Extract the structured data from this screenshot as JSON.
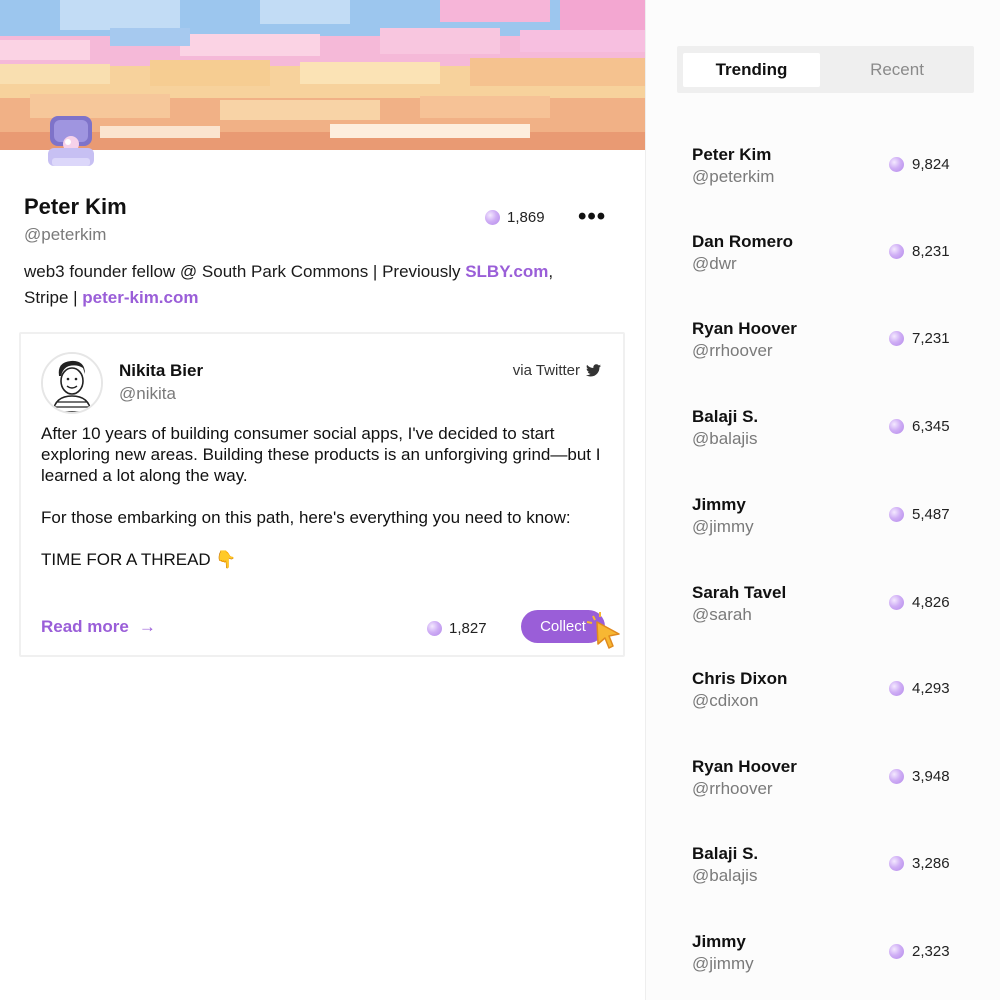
{
  "profile": {
    "name": "Peter Kim",
    "handle": "@peterkim",
    "points": "1,869",
    "more_label": "•••",
    "bio_text_1": "web3 founder fellow @ South Park Commons | Previously ",
    "bio_link_1": "SLBY.com",
    "bio_text_2": ",",
    "bio_text_3": "Stripe | ",
    "bio_link_2": "peter-kim.com"
  },
  "post": {
    "author_name": "Nikita Bier",
    "author_handle": "@nikita",
    "source": "via Twitter",
    "paragraphs": [
      "After 10 years of building consumer social apps, I've decided to start exploring new areas. Building these products is an unforgiving grind—but I learned a lot along the way.",
      "For those embarking on this path, here's everything you need to know:",
      "TIME FOR A THREAD 👇"
    ],
    "read_more_label": "Read more",
    "read_more_arrow": "→",
    "points": "1,827",
    "collect_label": "Collect"
  },
  "leaderboard": {
    "tabs": [
      {
        "label": "Trending",
        "active": true
      },
      {
        "label": "Recent",
        "active": false
      }
    ],
    "rows": [
      {
        "name": "Peter Kim",
        "handle": "@peterkim",
        "score": "9,824"
      },
      {
        "name": "Dan Romero",
        "handle": "@dwr",
        "score": "8,231"
      },
      {
        "name": "Ryan Hoover",
        "handle": "@rrhoover",
        "score": "7,231"
      },
      {
        "name": "Balaji S.",
        "handle": "@balajis",
        "score": "6,345"
      },
      {
        "name": "Jimmy",
        "handle": "@jimmy",
        "score": "5,487"
      },
      {
        "name": "Sarah Tavel",
        "handle": "@sarah",
        "score": "4,826"
      },
      {
        "name": "Chris Dixon",
        "handle": "@cdixon",
        "score": "4,293"
      },
      {
        "name": "Ryan Hoover",
        "handle": "@rrhoover",
        "score": "3,948"
      },
      {
        "name": "Balaji S.",
        "handle": "@balajis",
        "score": "3,286"
      },
      {
        "name": "Jimmy",
        "handle": "@jimmy",
        "score": "2,323"
      }
    ]
  },
  "colors": {
    "accent": "#9a5ed8",
    "orb": "#cfaef5",
    "muted_text": "#7a7a7a"
  },
  "icons": {
    "points": "pearl-orb-icon",
    "twitter": "twitter-bird-icon",
    "avatar": "oyster-pearl-icon",
    "cursor": "pointer-cursor-icon"
  }
}
